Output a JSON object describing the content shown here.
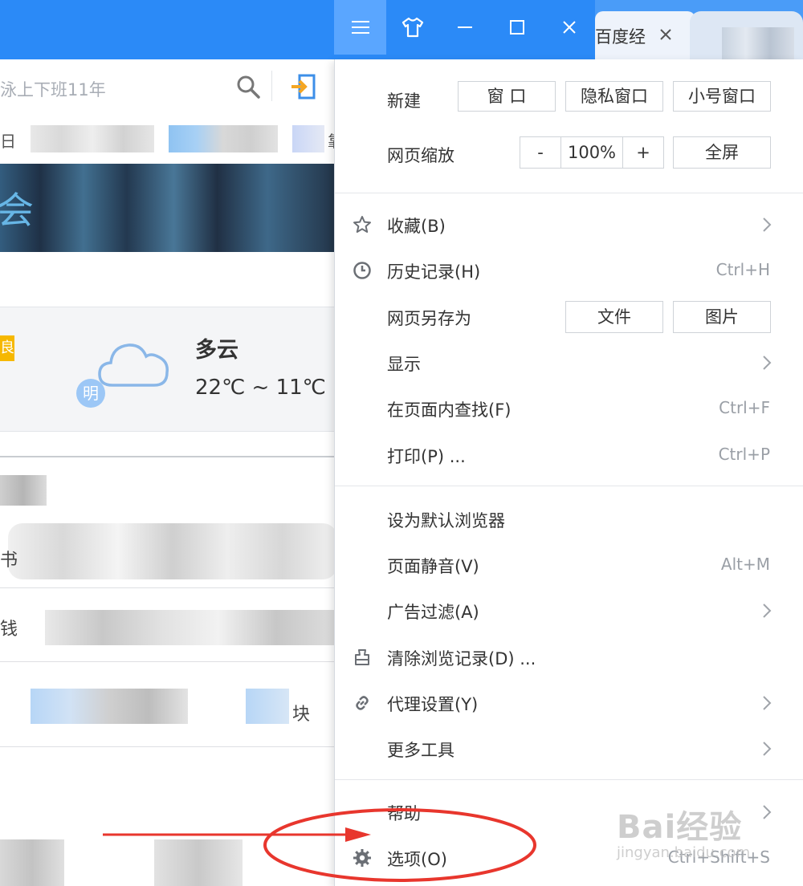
{
  "window_controls": {
    "menu_icon": "hamburger-icon",
    "skin_icon": "tshirt-icon",
    "minimize_icon": "minimize-icon",
    "maximize_icon": "maximize-icon",
    "close_icon": "close-icon"
  },
  "tabs": [
    {
      "title": "百度经",
      "close_icon": "close-icon"
    }
  ],
  "address_bar": {
    "text": "泳上下班11年",
    "search_icon": "search-icon",
    "login_icon": "login-icon"
  },
  "bookmarks": {
    "edge_text": "日",
    "edge_text_right": "靠"
  },
  "banner": {
    "glyph": "会"
  },
  "weather": {
    "badge": "良",
    "tomorrow_label": "明",
    "condition": "多云",
    "temperature": "22℃ ~ 11℃",
    "icon": "cloud-icon"
  },
  "content_edges": {
    "row1": "书",
    "row2": "钱",
    "row3": "块"
  },
  "menu": {
    "new": {
      "label": "新建",
      "buttons": [
        "窗 口",
        "隐私窗口",
        "小号窗口"
      ]
    },
    "zoom": {
      "label": "网页缩放",
      "minus": "-",
      "value": "100%",
      "plus": "+",
      "fullscreen": "全屏"
    },
    "items": [
      {
        "label": "收藏(B)",
        "icon": "star-icon",
        "shortcut": "",
        "submenu": true
      },
      {
        "label": "历史记录(H)",
        "icon": "clock-icon",
        "shortcut": "Ctrl+H",
        "submenu": false
      },
      {
        "label": "网页另存为",
        "icon": "",
        "shortcut": "",
        "submenu": false,
        "buttons": [
          "文件",
          "图片"
        ]
      },
      {
        "label": "显示",
        "icon": "",
        "shortcut": "",
        "submenu": true
      },
      {
        "label": "在页面内查找(F)",
        "icon": "",
        "shortcut": "Ctrl+F",
        "submenu": false
      },
      {
        "label": "打印(P) ...",
        "icon": "",
        "shortcut": "Ctrl+P",
        "submenu": false
      },
      {
        "label": "设为默认浏览器",
        "icon": "",
        "shortcut": "",
        "submenu": false
      },
      {
        "label": "页面静音(V)",
        "icon": "",
        "shortcut": "Alt+M",
        "submenu": false
      },
      {
        "label": "广告过滤(A)",
        "icon": "",
        "shortcut": "",
        "submenu": true
      },
      {
        "label": "清除浏览记录(D) ...",
        "icon": "eraser-icon",
        "shortcut": "",
        "submenu": false
      },
      {
        "label": "代理设置(Y)",
        "icon": "link-icon",
        "shortcut": "",
        "submenu": true
      },
      {
        "label": "更多工具",
        "icon": "",
        "shortcut": "",
        "submenu": true
      },
      {
        "label": "帮助",
        "icon": "",
        "shortcut": "",
        "submenu": true
      },
      {
        "label": "选项(O)",
        "icon": "gear-icon",
        "shortcut": "Ctrl+Shift+S",
        "submenu": false
      }
    ]
  },
  "annotation": {
    "color": "#e8362d",
    "shape": "ellipse-with-arrow",
    "target": "选项(O)"
  },
  "watermark": {
    "logo": "Bai经验",
    "url": "jingyan.baidu.com"
  },
  "colors": {
    "title_bar": "#2b8af7",
    "active_button": "#5aa6ff",
    "menu_text": "#333333",
    "shortcut_text": "#9a9fa6",
    "badge_yellow": "#f6b800"
  }
}
